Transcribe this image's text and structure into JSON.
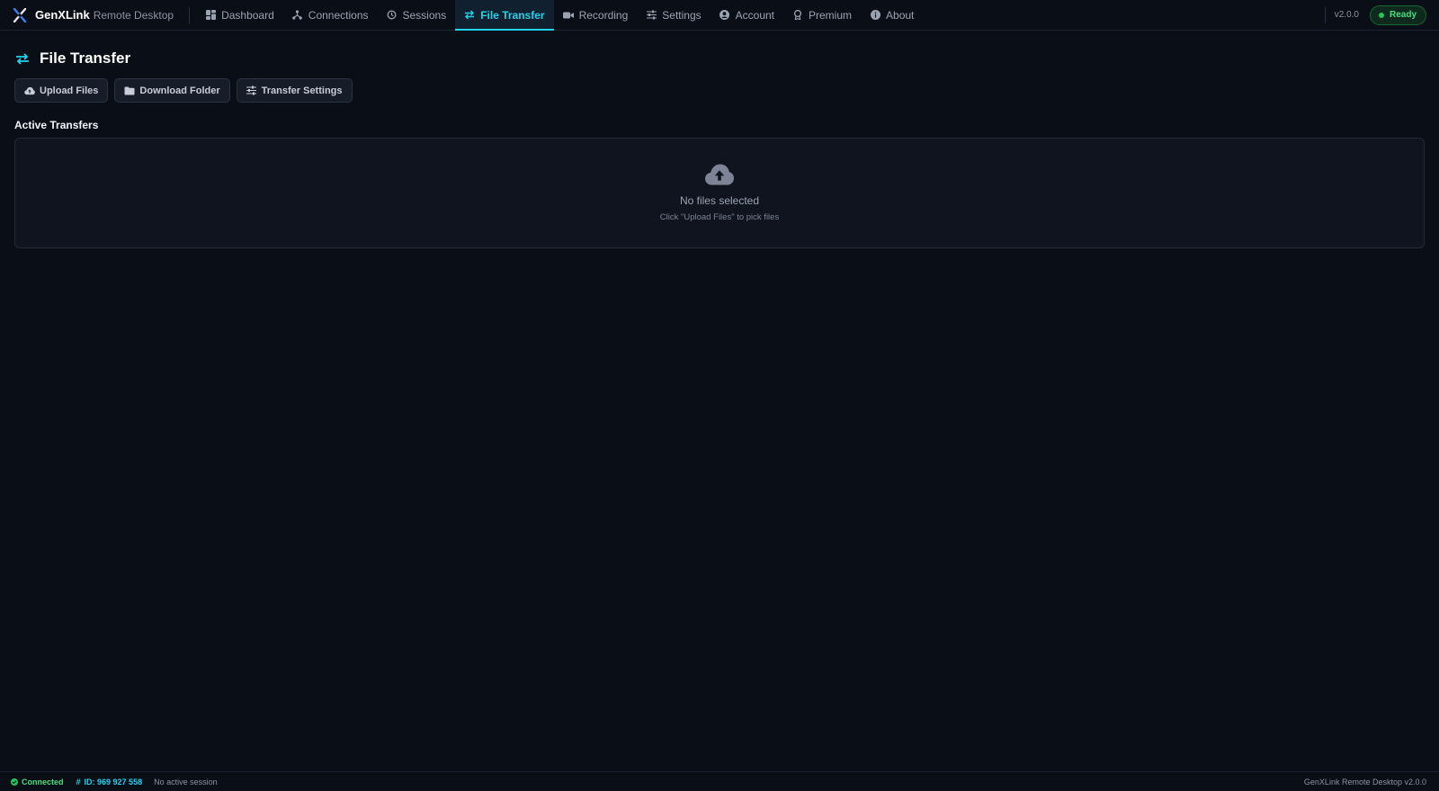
{
  "app": {
    "name": "GenXLink",
    "subtitle": "Remote Desktop"
  },
  "nav": {
    "items": [
      {
        "label": "Dashboard",
        "icon": "dashboard-icon"
      },
      {
        "label": "Connections",
        "icon": "network-icon"
      },
      {
        "label": "Sessions",
        "icon": "history-icon"
      },
      {
        "label": "File Transfer",
        "icon": "transfer-arrows-icon",
        "active": true
      },
      {
        "label": "Recording",
        "icon": "video-camera-icon"
      },
      {
        "label": "Settings",
        "icon": "sliders-icon"
      },
      {
        "label": "Account",
        "icon": "user-circle-icon"
      },
      {
        "label": "Premium",
        "icon": "award-icon"
      },
      {
        "label": "About",
        "icon": "info-circle-icon"
      }
    ]
  },
  "topbar": {
    "version": "v2.0.0",
    "status": "Ready"
  },
  "page": {
    "title": "File Transfer",
    "actions": {
      "upload": "Upload Files",
      "download": "Download Folder",
      "settings": "Transfer Settings"
    },
    "active_transfers": {
      "heading": "Active Transfers",
      "empty_title": "No files selected",
      "empty_hint": "Click \"Upload Files\" to pick files"
    }
  },
  "statusbar": {
    "connection": "Connected",
    "id_label": "ID: 969 927 558",
    "session": "No active session",
    "footer": "GenXLink Remote Desktop v2.0.0"
  },
  "colors": {
    "accent": "#22d3ee",
    "success": "#22c55e",
    "background": "#0a0e17"
  }
}
